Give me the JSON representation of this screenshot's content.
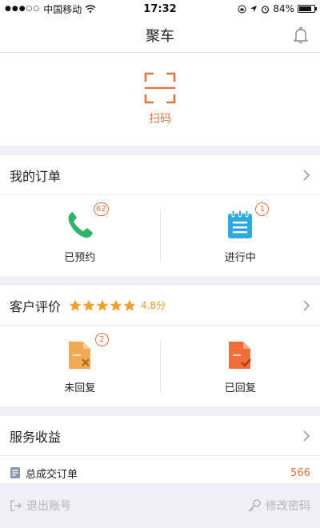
{
  "status_bar": {
    "carrier": "中国移动",
    "time": "17:32",
    "battery": "84%",
    "battery_level": 0.84
  },
  "nav": {
    "title": "聚车"
  },
  "scan": {
    "label": "扫码"
  },
  "orders": {
    "title": "我的订单",
    "items": [
      {
        "label": "已预约",
        "badge": "62",
        "icon": "phone-icon",
        "color": "#2fb36a"
      },
      {
        "label": "进行中",
        "badge": "1",
        "icon": "notepad-icon",
        "color": "#2ea8e0"
      }
    ]
  },
  "reviews": {
    "title": "客户评价",
    "rating": 4.8,
    "rating_text": "4.8分",
    "items": [
      {
        "label": "未回复",
        "badge": "2",
        "icon": "doc-x-icon",
        "color": "#efaa55"
      },
      {
        "label": "已回复",
        "icon": "doc-check-icon",
        "color": "#ef6e3c"
      }
    ]
  },
  "service": {
    "title": "服务收益",
    "row_label": "总成交订单",
    "row_value": "566"
  },
  "footer": {
    "logout": "退出账号",
    "change_password": "修改密码"
  },
  "colors": {
    "accent": "#e07443",
    "star": "#f0a030"
  }
}
